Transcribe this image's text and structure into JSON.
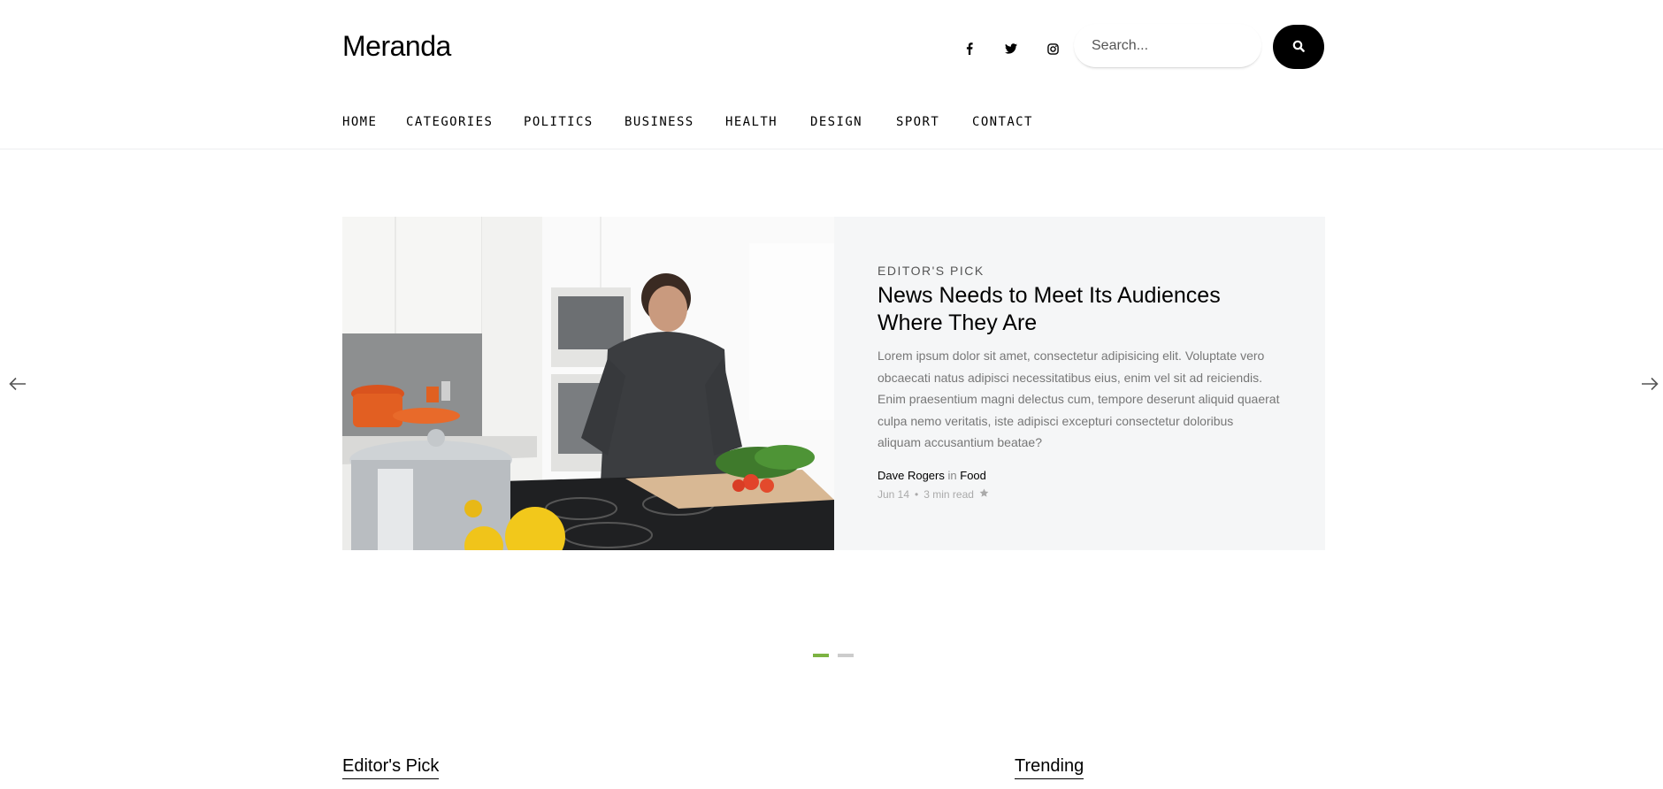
{
  "site": {
    "logo": "Meranda"
  },
  "header": {
    "social": [
      {
        "icon": "facebook-icon",
        "glyph": "f"
      },
      {
        "icon": "twitter-icon",
        "glyph": "t"
      },
      {
        "icon": "instagram-icon",
        "glyph": "ig"
      }
    ],
    "search": {
      "placeholder": "Search...",
      "button_icon": "search-icon"
    }
  },
  "nav": {
    "items": [
      "HOME",
      "CATEGORIES",
      "POLITICS",
      "BUSINESS",
      "HEALTH",
      "DESIGN",
      "SPORT",
      "CONTACT"
    ]
  },
  "hero": {
    "kicker": "EDITOR'S PICK",
    "title": "News Needs to Meet Its Audiences Where They Are",
    "excerpt": "Lorem ipsum dolor sit amet, consectetur adipisicing elit. Voluptate vero obcaecati natus adipisci necessitatibus eius, enim vel sit ad reiciendis. Enim praesentium magni delectus cum, tempore deserunt aliquid quaerat culpa nemo veritatis, iste adipisci excepturi consectetur doloribus aliquam accusantium beatae?",
    "author": "Dave Rogers",
    "in_word": "in",
    "category": "Food",
    "date": "Jun 14",
    "separator": "•",
    "read_time": "3 min read",
    "star_icon": "star-icon"
  },
  "carousel": {
    "prev_icon": "arrow-left-icon",
    "next_icon": "arrow-right-icon",
    "active_color": "#7cb342",
    "inactive_color": "#cccccc"
  },
  "sections": {
    "left": "Editor's Pick",
    "right": "Trending"
  }
}
